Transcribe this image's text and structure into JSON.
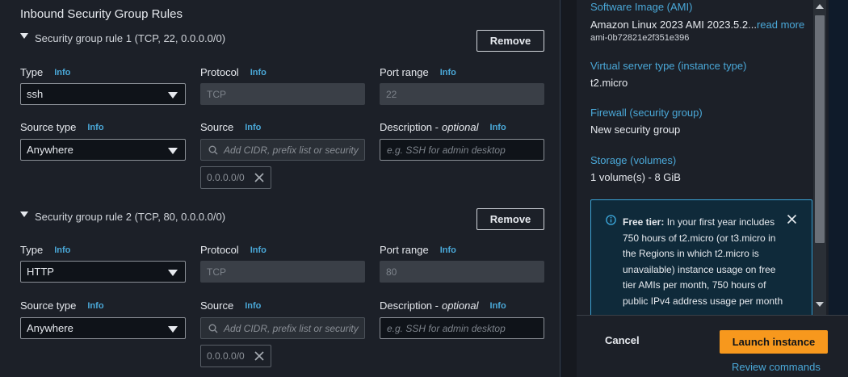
{
  "inbound": {
    "title": "Inbound Security Group Rules",
    "rules": [
      {
        "header": "Security group rule 1 (TCP, 22, 0.0.0.0/0)",
        "remove_label": "Remove",
        "type_label": "Type",
        "type_value": "ssh",
        "protocol_label": "Protocol",
        "protocol_value": "TCP",
        "port_label": "Port range",
        "port_value": "22",
        "source_type_label": "Source type",
        "source_type_value": "Anywhere",
        "source_label": "Source",
        "source_placeholder": "Add CIDR, prefix list or security",
        "source_token": "0.0.0.0/0",
        "desc_label": "Description -",
        "desc_optional": "optional",
        "desc_placeholder": "e.g. SSH for admin desktop"
      },
      {
        "header": "Security group rule 2 (TCP, 80, 0.0.0.0/0)",
        "remove_label": "Remove",
        "type_label": "Type",
        "type_value": "HTTP",
        "protocol_label": "Protocol",
        "protocol_value": "TCP",
        "port_label": "Port range",
        "port_value": "80",
        "source_type_label": "Source type",
        "source_type_value": "Anywhere",
        "source_label": "Source",
        "source_placeholder": "Add CIDR, prefix list or security",
        "source_token": "0.0.0.0/0",
        "desc_label": "Description -",
        "desc_optional": "optional",
        "desc_placeholder": "e.g. SSH for admin desktop"
      }
    ],
    "info_label": "Info"
  },
  "summary": {
    "ami_label": "Software Image (AMI)",
    "ami_value": "Amazon Linux 2023 AMI 2023.5.2...",
    "ami_read_more": "read more",
    "ami_id": "ami-0b72821e2f351e396",
    "instance_type_label": "Virtual server type (instance type)",
    "instance_type_value": "t2.micro",
    "firewall_label": "Firewall (security group)",
    "firewall_value": "New security group",
    "storage_label": "Storage (volumes)",
    "storage_value": "1 volume(s) - 8 GiB",
    "free_tier_bold": "Free tier:",
    "free_tier_text": "In your first year includes 750 hours of t2.micro (or t3.micro in the Regions in which t2.micro is unavailable) instance usage on free tier AMIs per month, 750 hours of public IPv4 address usage per month"
  },
  "footer": {
    "cancel_label": "Cancel",
    "launch_label": "Launch instance",
    "review_label": "Review commands"
  },
  "colors": {
    "accent_link": "#4aa8d8",
    "primary_button": "#f7981d",
    "panel_bg": "#1c2028"
  },
  "icons": [
    "caret-down-icon",
    "dropdown-arrow-icon",
    "search-icon",
    "remove-token-icon",
    "info-circle-icon",
    "close-icon",
    "scroll-up-icon",
    "scroll-down-icon"
  ]
}
